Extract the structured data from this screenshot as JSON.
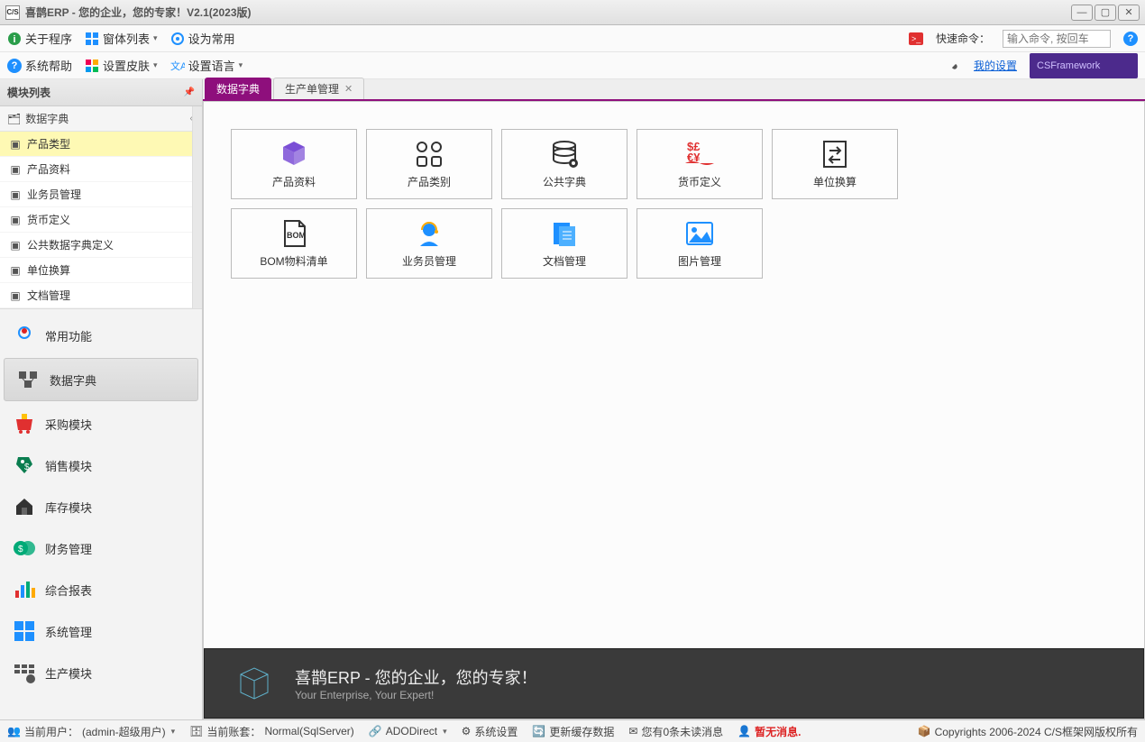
{
  "window": {
    "title": "喜鹊ERP - 您的企业，您的专家！V2.1(2023版)",
    "app_icon_text": "C/S"
  },
  "toolbar1": {
    "about": "关于程序",
    "formlist": "窗体列表",
    "setdefault": "设为常用",
    "quickcmd_label": "快速命令：",
    "quickcmd_placeholder": "输入命令, 按回车"
  },
  "toolbar2": {
    "syshelp": "系统帮助",
    "skin": "设置皮肤",
    "lang": "设置语言",
    "mysettings": "我的设置",
    "csframework": "CSFramework"
  },
  "sidebar": {
    "header": "模块列表",
    "tree_head": "数据字典",
    "tree_items": [
      "产品类型",
      "产品资料",
      "业务员管理",
      "货币定义",
      "公共数据字典定义",
      "单位换算",
      "文档管理"
    ],
    "modules": [
      "常用功能",
      "数据字典",
      "采购模块",
      "销售模块",
      "库存模块",
      "财务管理",
      "综合报表",
      "系统管理",
      "生产模块"
    ]
  },
  "tabs": [
    {
      "label": "数据字典",
      "active": true,
      "closable": false
    },
    {
      "label": "生产单管理",
      "active": false,
      "closable": true
    }
  ],
  "tiles": [
    {
      "label": "产品资料",
      "icon": "cube-purple"
    },
    {
      "label": "产品类别",
      "icon": "grid"
    },
    {
      "label": "公共字典",
      "icon": "database-gear"
    },
    {
      "label": "货币定义",
      "icon": "currency"
    },
    {
      "label": "单位换算",
      "icon": "convert"
    },
    {
      "label": "BOM物料清单",
      "icon": "bom"
    },
    {
      "label": "业务员管理",
      "icon": "headset"
    },
    {
      "label": "文档管理",
      "icon": "doc"
    },
    {
      "label": "图片管理",
      "icon": "image"
    }
  ],
  "banner": {
    "title": "喜鹊ERP - 您的企业，您的专家！",
    "subtitle": "Your Enterprise, Your Expert!"
  },
  "statusbar": {
    "user_label": "当前用户：",
    "user_value": "(admin-超级用户)",
    "account_label": "当前账套：",
    "account_value": "Normal(SqlServer)",
    "ado": "ADODirect",
    "syssettings": "系统设置",
    "refresh": "更新缓存数据",
    "msgs": "您有0条未读消息",
    "nomsg": "暂无消息.",
    "copyright": "Copyrights 2006-2024 C/S框架网版权所有"
  }
}
